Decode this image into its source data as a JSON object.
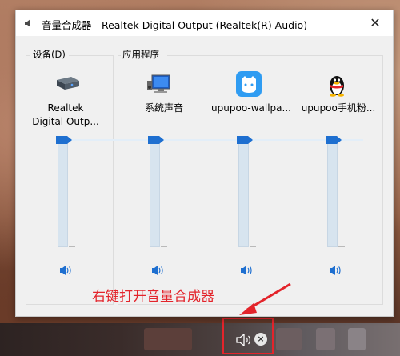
{
  "window": {
    "title": "音量合成器 - Realtek Digital Output (Realtek(R) Audio)",
    "close_glyph": "✕"
  },
  "sections": {
    "device_label": "设备(D)",
    "apps_label": "应用程序"
  },
  "channels": [
    {
      "name": "Realtek\nDigital Outp...",
      "icon": "speaker-device-icon",
      "volume": 1.0,
      "muted": false
    },
    {
      "name": "系统声音",
      "icon": "system-sounds-icon",
      "volume": 1.0,
      "muted": false
    },
    {
      "name": "upupoo-wallpa...",
      "icon": "upupoo-wallpaper-icon",
      "volume": 1.0,
      "muted": false
    },
    {
      "name": "upupoo手机粉...",
      "icon": "qq-penguin-icon",
      "volume": 1.0,
      "muted": false
    }
  ],
  "annotation": {
    "text": "右键打开音量合成器",
    "color": "#e3242b"
  },
  "colors": {
    "accent": "#1e6fd0",
    "highlight": "#e3242b"
  }
}
